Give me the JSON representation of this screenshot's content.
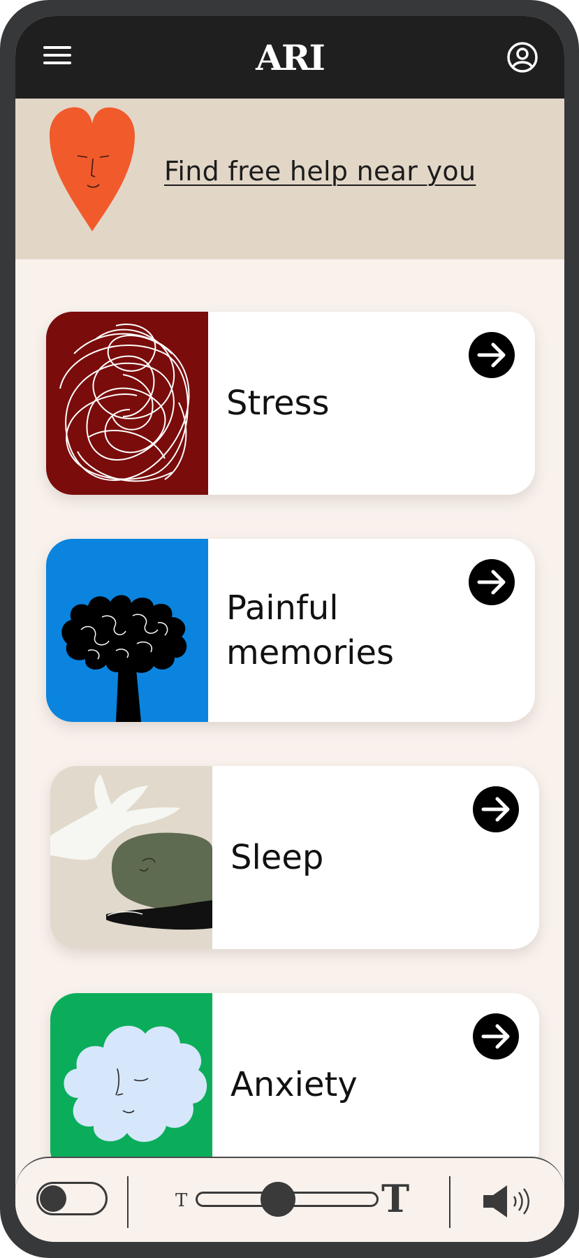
{
  "header": {
    "logo_text": "ARI",
    "menu_icon": "hamburger-menu-icon",
    "profile_icon": "user-profile-icon"
  },
  "banner": {
    "link_text": "Find free help near you",
    "illustration": "heart-face-illustration",
    "heart_color": "#f15a2b"
  },
  "cards": [
    {
      "label": "Stress",
      "art_bg": "#7a0c0c",
      "illustration": "scribble-illustration"
    },
    {
      "label": "Painful memories",
      "art_bg": "#0a84df",
      "illustration": "brain-tree-illustration"
    },
    {
      "label": "Sleep",
      "art_bg": "#e1d9cc",
      "illustration": "sleeping-head-illustration"
    },
    {
      "label": "Anxiety",
      "art_bg": "#0bad5a",
      "illustration": "cloud-face-illustration"
    }
  ],
  "accessibility_bar": {
    "toggle_on": false,
    "text_size_small_glyph": "T",
    "text_size_large_glyph": "T",
    "text_size_level": 0.45,
    "speaker_icon": "speaker-sound-icon"
  }
}
